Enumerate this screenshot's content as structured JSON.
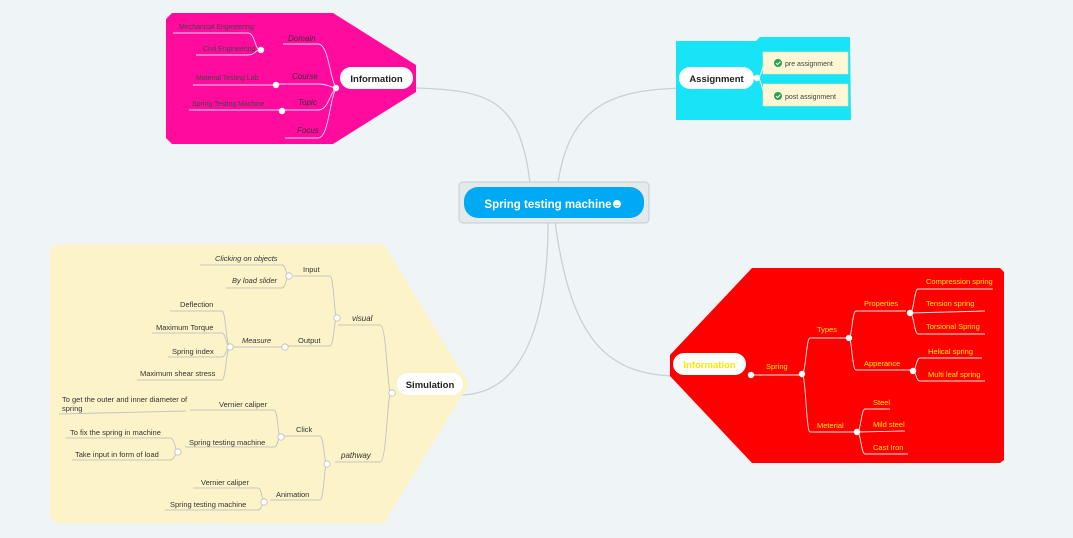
{
  "central": {
    "label": "Spring testing machine",
    "icon": "smiley-icon"
  },
  "info_top": {
    "title": "Information",
    "domain": {
      "label": "Domain",
      "children": [
        "Mechanical Engineering",
        "Civil Engineering"
      ]
    },
    "course": {
      "label": "Course",
      "children": [
        "Material Testing Lab"
      ]
    },
    "topic": {
      "label": "Topic",
      "children": [
        "Spring Testing Machine"
      ]
    },
    "focus": {
      "label": "Focus"
    },
    "color": "#ff0b9e"
  },
  "assignment": {
    "title": "Assignment",
    "items": [
      "pre assignment",
      "post assignment"
    ],
    "item_icon": "checkmark-icon",
    "color": "#17e5f7"
  },
  "simulation": {
    "title": "Simulation",
    "color": "#fdf3c9",
    "visual": {
      "label": "visual",
      "input": {
        "label": "Input",
        "children": [
          "Clicking on objects",
          "By load slider"
        ]
      },
      "output": {
        "label": "Output",
        "measure": {
          "label": "Measure",
          "children": [
            "Deflection",
            "Maximum Torque",
            "Spring index",
            "Maximum shear stress"
          ]
        }
      }
    },
    "pathway": {
      "label": "pathway",
      "click": {
        "label": "Click",
        "vernier": {
          "label": "Vernier caliper",
          "children": [
            "To get the outer and inner diameter of",
            "spring"
          ]
        },
        "machine": {
          "label": "Spring testing machine",
          "children": [
            "To fix the spring in machine",
            "Take input in form of load"
          ]
        }
      },
      "animation": {
        "label": "Animation",
        "children": [
          "Vernier caliper",
          "Spring testing machine"
        ]
      }
    }
  },
  "info_bottom": {
    "title": "Information",
    "color": "#ff0000",
    "text_color": "#ffe800",
    "spring": {
      "label": "Spring",
      "types": {
        "label": "Types",
        "properties": {
          "label": "Properties",
          "children": [
            "Compression spring",
            "Tension spring",
            "Torsional Spring"
          ]
        },
        "apperance": {
          "label": "Apperance",
          "children": [
            "Helical spring",
            "Multi leaf spring"
          ]
        }
      },
      "meterial": {
        "label": "Meterial",
        "children": [
          "Steel",
          "Mild steel",
          "Cast Iron"
        ]
      }
    }
  }
}
